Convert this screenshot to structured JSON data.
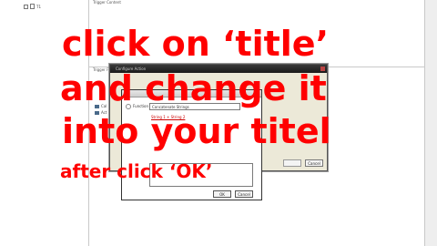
{
  "app": {
    "tree": {
      "item_label": "T1"
    },
    "top_panel": {
      "header": "Trigger Content"
    },
    "bottom_panel": {
      "header": "Trigger Funct",
      "items": [
        {
          "label": "Cal"
        },
        {
          "label": "Act"
        }
      ]
    }
  },
  "dialog": {
    "title": "Configure Action",
    "cancel_label": "Cancel",
    "function_label": "Function",
    "function_value": "Concatenate Strings",
    "string_link": "String 1 + String 2",
    "ok_label": "OK",
    "inner_cancel_label": "Cancel"
  },
  "overlay": {
    "line1": "click on ‘title’",
    "line2": "and change it",
    "line3": "into your titel",
    "line4": "after click ‘OK’"
  }
}
